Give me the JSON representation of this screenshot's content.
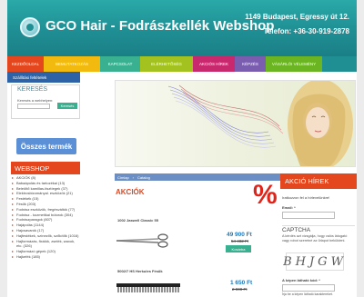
{
  "header": {
    "title": "GCO Hair - Fodrászkellék Webshop",
    "address": "1149 Budapest, Egressy út 12.",
    "phone": "Telefon: +36-30-919-2878"
  },
  "nav": {
    "items": [
      {
        "label": "Kezdőoldal",
        "color": "#e4461e"
      },
      {
        "label": "Bemutatkozás",
        "color": "#f2b90e"
      },
      {
        "label": "Kapcsolat",
        "color": "#39b08f"
      },
      {
        "label": "Elérhetőség",
        "color": "#a4c21f"
      },
      {
        "label": "Akciós hírek",
        "color": "#c8286e"
      },
      {
        "label": "Képzés",
        "color": "#7b5db0"
      },
      {
        "label": "Vásárlói vélemény",
        "color": "#6ab521"
      }
    ],
    "sub_item": "Szállítási feltételek"
  },
  "search": {
    "title": "KERESÉS",
    "label": "Keresés a webhelyen:",
    "placeholder": "",
    "button": "Keresés"
  },
  "all_products": "Összes termék",
  "webshop": {
    "title": "WEBSHOP",
    "categories": [
      "AKCIÓK (8)",
      "Babaápolás és tartozékai (13)",
      "Beleöltő kamillas-tisztíegek (37)",
      "Elektrosbizományal. eszközök (21)",
      "Festékék (15)",
      "Fésűk (203)",
      "Fodrász eszközök, fregésváltók (77)",
      "Fodrász - kozmetikai bútorok (304)",
      "Fodrászparagok (807)",
      "Hajápolás (1144)",
      "Hajcsavarók (17)",
      "Hajfestékek, színezők, szőkítők (1016)",
      "Hajformázás, fixálók, zselék, waxok, etc. (326)",
      "Hajformázó gépek (120)",
      "Hajkefék (185)"
    ]
  },
  "breadcrumb": [
    "Címlap",
    "Catalog"
  ],
  "offers": {
    "title": "AKCIÓK",
    "percent_sign": "%",
    "products": [
      {
        "name": "1002 Jaswell Classic 55",
        "price": "49 900 Ft",
        "old_price": "54 482 Ft",
        "button": "Kosárba"
      },
      {
        "name": "5002/7 HS Herkules Fésűk",
        "price": "1 650 Ft",
        "old_price": "2 908 Ft",
        "button": "Kosárba"
      }
    ]
  },
  "news": {
    "title": "AKCIÓ HÍREK",
    "subscribe_text": "Iratkozzon fel a hírlevelünkre!",
    "email_label": "Email: *",
    "captcha_title": "CAPTCHA",
    "captcha_text": "A kérdés azt vizsgálja, hogy valós látogató vagy robot szeretné az űrlapot beküldeni.",
    "captcha_code": "BHJGW",
    "captcha_label": "A képen látható kód: *",
    "captcha_hint": "Írja be a képen látható karaktereket."
  }
}
